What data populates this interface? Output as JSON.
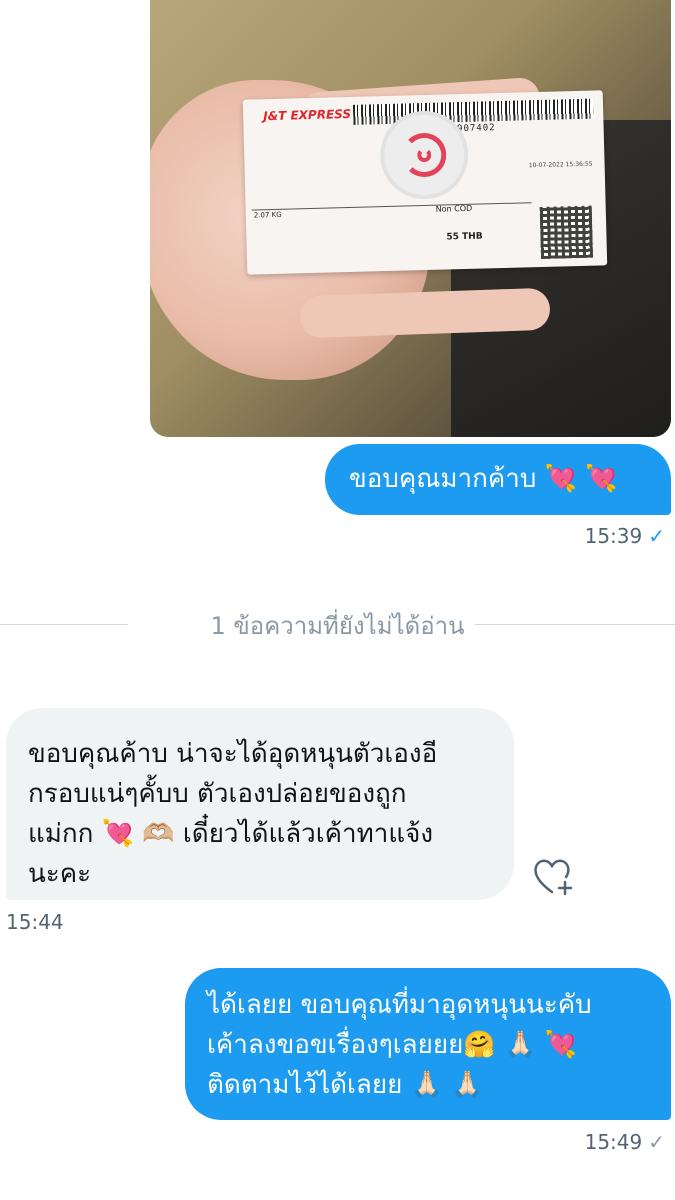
{
  "photo": {
    "courier_brand": "J&T EXPRESS",
    "tracking_number": "822411907402",
    "date": "10-07-2022 15:36:55",
    "weight": "2.07 KG",
    "cod_label": "Non COD",
    "price": "55 THB"
  },
  "messages": [
    {
      "direction": "outgoing",
      "text": "ขอบคุณมากค้าบ 💘 💘",
      "time": "15:39",
      "status": "read"
    },
    {
      "direction": "incoming",
      "lines": [
        "ขอบคุณค้าบ น่าจะได้อุดหนุนตัวเองอี",
        "กรอบแน่ๆคั้บบ ตัวเองปล่อยของถูก",
        "แม่กก 💘 🫶🏼 เดี๋ยวได้แล้วเค้าทาแจ้ง",
        "นะคะ"
      ],
      "time": "15:44"
    },
    {
      "direction": "outgoing",
      "lines": [
        "ได้เลยย ขอบคุณที่มาอุดหนุนนะคับ",
        "เค้าลงขอขเรื่องๆเลยยย🤗 🙏🏻 💘",
        "ติดตามไว้ได้เลยย 🙏🏻 🙏🏻"
      ],
      "time": "15:49",
      "status": "sent"
    }
  ],
  "unread_divider": "1 ข้อความที่ยังไม่ได้อ่าน",
  "icons": {
    "read_check": "check-icon",
    "sent_check": "check-icon",
    "react": "heart-plus-icon"
  },
  "colors": {
    "outgoing_bubble": "#1d9bf0",
    "incoming_bubble": "#eff3f4",
    "timestamp": "#536471"
  }
}
